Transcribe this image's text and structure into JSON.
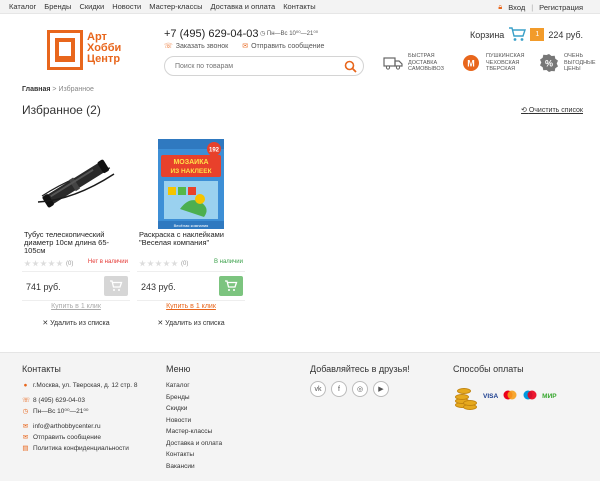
{
  "topnav": [
    "Каталог",
    "Бренды",
    "Скидки",
    "Новости",
    "Мастер-классы",
    "Доставка и оплата",
    "Контакты"
  ],
  "auth": {
    "login": "Вход",
    "register": "Регистрация"
  },
  "logo": {
    "line1": "Арт",
    "line2": "Хобби",
    "line3": "Центр"
  },
  "header": {
    "phone": "+7 (495) 629-04-03",
    "hours": "Пн—Вс 10⁰⁰—21⁰⁰",
    "callback": "Заказать звонок",
    "send_message": "Отправить сообщение"
  },
  "search": {
    "placeholder": "Поиск по товарам"
  },
  "features": [
    {
      "icon": "delivery-truck-icon",
      "text": "Быстрая доставка самовывоз"
    },
    {
      "icon": "metro-icon",
      "text": "Пушкинская Чеховская Тверская"
    },
    {
      "icon": "percent-icon",
      "text": "Очень выгодные цены"
    }
  ],
  "cart": {
    "label": "Корзина",
    "count": "1",
    "total": "224 руб."
  },
  "breadcrumb": {
    "home": "Главная",
    "current": "Избранное"
  },
  "page": {
    "title": "Избранное (2)",
    "clear": "Очистить список"
  },
  "products": [
    {
      "name": "Тубус телескопический диаметр 10см длина 65-105см",
      "reviews": "(0)",
      "availability": "Нет в наличии",
      "price": "741 руб.",
      "one_click": "Купить в 1 клик",
      "remove": "Удалить из списка",
      "in_stock": false
    },
    {
      "name": "Раскраска с наклейками \"Веселая компания\"",
      "reviews": "(0)",
      "availability": "В наличии",
      "price": "243 руб.",
      "one_click": "Купить в 1 клик",
      "remove": "Удалить из списка",
      "in_stock": true,
      "cover_title": "МОЗАИКА ИЗ НАКЛЕЕК",
      "cover_count": "192",
      "cover_sub": "Весёлая компания"
    }
  ],
  "footer": {
    "contacts_title": "Контакты",
    "address": "г.Москва, ул. Тверская, д. 12 стр. 8",
    "phone": "8 (495) 629-04-03",
    "hours": "Пн—Вс 10⁰⁰—21⁰⁰",
    "email": "info@arthobbycenter.ru",
    "send_message": "Отправить сообщение",
    "privacy": "Политика конфиденциальности",
    "menu_title": "Меню",
    "menu": [
      "Каталог",
      "Бренды",
      "Скидки",
      "Новости",
      "Мастер-классы",
      "Доставка и оплата",
      "Контакты",
      "Вакансии"
    ],
    "friends_title": "Добавляйтесь в друзья!",
    "socials": [
      "vk-icon",
      "facebook-icon",
      "instagram-icon",
      "youtube-icon"
    ],
    "payment_title": "Способы оплаты",
    "payments": [
      "VISA",
      "mastercard",
      "mastercard",
      "МИР"
    ]
  },
  "colors": {
    "accent": "#e8661c",
    "orange_badge": "#f29b2a",
    "green": "#7cc47f",
    "out_of_stock": "#e53935",
    "in_stock": "#3aa04a"
  }
}
